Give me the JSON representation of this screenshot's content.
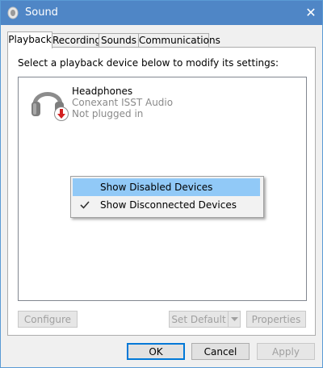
{
  "window": {
    "title": "Sound",
    "close_glyph": "✕",
    "accent_color": "#4f86c6"
  },
  "tabs": [
    {
      "label": "Playback",
      "active": true
    },
    {
      "label": "Recording",
      "active": false
    },
    {
      "label": "Sounds",
      "active": false
    },
    {
      "label": "Communications",
      "active": false
    }
  ],
  "playback": {
    "instruction": "Select a playback device below to modify its settings:",
    "devices": [
      {
        "name": "Headphones",
        "driver": "Conexant ISST Audio",
        "status": "Not plugged in",
        "icon": "headphones-icon",
        "status_icon": "red-down-arrow-icon"
      }
    ]
  },
  "context_menu": {
    "items": [
      {
        "label": "Show Disabled Devices",
        "checked": false,
        "highlighted": true
      },
      {
        "label": "Show Disconnected Devices",
        "checked": true,
        "highlighted": false
      }
    ]
  },
  "device_buttons": {
    "configure": "Configure",
    "set_default": "Set Default",
    "properties": "Properties"
  },
  "dialog_buttons": {
    "ok": "OK",
    "cancel": "Cancel",
    "apply": "Apply"
  }
}
